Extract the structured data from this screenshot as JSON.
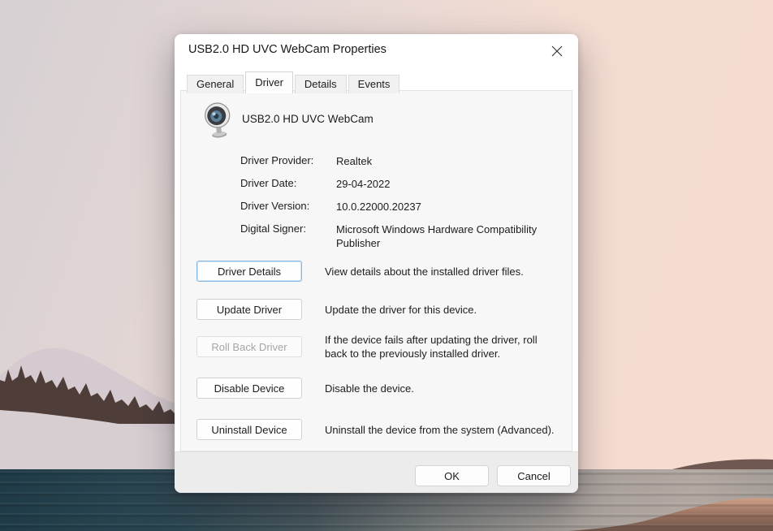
{
  "window": {
    "title": "USB2.0 HD UVC WebCam Properties"
  },
  "tabs": [
    {
      "label": "General",
      "selected": false
    },
    {
      "label": "Driver",
      "selected": true
    },
    {
      "label": "Details",
      "selected": false
    },
    {
      "label": "Events",
      "selected": false
    }
  ],
  "device": {
    "name": "USB2.0 HD UVC WebCam",
    "icon": "webcam-icon"
  },
  "driver_info": [
    {
      "label": "Driver Provider:",
      "value": "Realtek"
    },
    {
      "label": "Driver Date:",
      "value": "29-04-2022"
    },
    {
      "label": "Driver Version:",
      "value": "10.0.22000.20237"
    },
    {
      "label": "Digital Signer:",
      "value": "Microsoft Windows Hardware Compatibility Publisher"
    }
  ],
  "actions": [
    {
      "button": "Driver Details",
      "description": "View details about the installed driver files.",
      "enabled": true,
      "focused": true
    },
    {
      "button": "Update Driver",
      "description": "Update the driver for this device.",
      "enabled": true,
      "focused": false
    },
    {
      "button": "Roll Back Driver",
      "description": "If the device fails after updating the driver, roll back to the previously installed driver.",
      "enabled": false,
      "focused": false
    },
    {
      "button": "Disable Device",
      "description": "Disable the device.",
      "enabled": true,
      "focused": false
    },
    {
      "button": "Uninstall Device",
      "description": "Uninstall the device from the system (Advanced).",
      "enabled": true,
      "focused": false
    }
  ],
  "footer": {
    "ok_label": "OK",
    "cancel_label": "Cancel"
  },
  "icons": {
    "close": "close-icon",
    "device": "webcam-icon"
  },
  "colors": {
    "focus_border": "#86b7e2",
    "dialog_bg": "#ffffff",
    "content_bg": "#f8f7f7",
    "footer_bg": "#ececec",
    "water_teal": "#1f3b47",
    "sky_pink": "#f6dcd0"
  }
}
